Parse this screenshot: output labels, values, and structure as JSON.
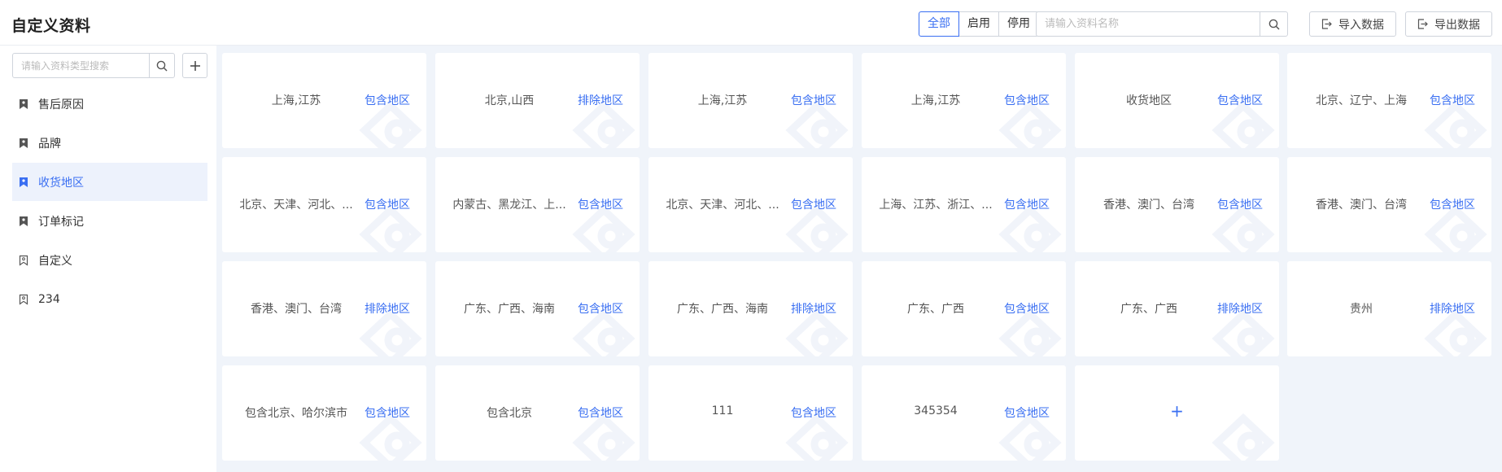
{
  "header": {
    "title": "自定义资料",
    "filters": [
      "全部",
      "启用",
      "停用"
    ],
    "search_placeholder": "请输入资料名称",
    "import_label": "导入数据",
    "export_label": "导出数据"
  },
  "sidebar": {
    "search_placeholder": "请输入资料类型搜索",
    "items": [
      {
        "label": "售后原因",
        "active": false
      },
      {
        "label": "品牌",
        "active": false
      },
      {
        "label": "收货地区",
        "active": true
      },
      {
        "label": "订单标记",
        "active": false
      },
      {
        "label": "自定义",
        "active": false
      },
      {
        "label": "234",
        "active": false
      }
    ]
  },
  "cards": [
    {
      "name": "上海,江苏",
      "type": "包含地区"
    },
    {
      "name": "北京,山西",
      "type": "排除地区"
    },
    {
      "name": "上海,江苏",
      "type": "包含地区"
    },
    {
      "name": "上海,江苏",
      "type": "包含地区"
    },
    {
      "name": "收货地区",
      "type": "包含地区"
    },
    {
      "name": "北京、辽宁、上海",
      "type": "包含地区"
    },
    {
      "name": "北京、天津、河北、...",
      "type": "包含地区"
    },
    {
      "name": "内蒙古、黑龙江、上...",
      "type": "包含地区"
    },
    {
      "name": "北京、天津、河北、...",
      "type": "包含地区"
    },
    {
      "name": "上海、江苏、浙江、...",
      "type": "包含地区"
    },
    {
      "name": "香港、澳门、台湾",
      "type": "包含地区"
    },
    {
      "name": "香港、澳门、台湾",
      "type": "包含地区"
    },
    {
      "name": "香港、澳门、台湾",
      "type": "排除地区"
    },
    {
      "name": "广东、广西、海南",
      "type": "包含地区"
    },
    {
      "name": "广东、广西、海南",
      "type": "排除地区"
    },
    {
      "name": "广东、广西",
      "type": "包含地区"
    },
    {
      "name": "广东、广西",
      "type": "排除地区"
    },
    {
      "name": "贵州",
      "type": "排除地区"
    },
    {
      "name": "包含北京、哈尔滨市",
      "type": "包含地区"
    },
    {
      "name": "包含北京",
      "type": "包含地区"
    },
    {
      "name": "111",
      "type": "包含地区"
    },
    {
      "name": "345354",
      "type": "包含地区"
    }
  ],
  "add_card_label": "+",
  "colors": {
    "accent": "#3a6ff2",
    "background": "#f0f4fa"
  }
}
